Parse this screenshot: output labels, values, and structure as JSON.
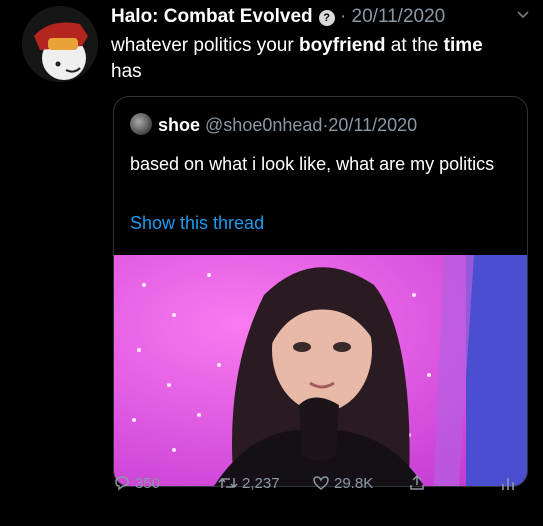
{
  "tweet": {
    "author_name": "Halo: Combat Evolved",
    "separator": "·",
    "date": "20/11/2020",
    "text_part1": "whatever politics your ",
    "text_bold1": "boyfriend",
    "text_part2": " at the ",
    "text_bold2": "time",
    "text_part3": " has"
  },
  "quote": {
    "author_name": "shoe",
    "handle": "@shoe0nhead",
    "separator": "·",
    "date": "20/11/2020",
    "text": "based on what i look like, what are my politics",
    "thread_link": "Show this thread"
  },
  "actions": {
    "replies": "350",
    "retweets": "2,237",
    "likes": "29.8K"
  },
  "colors": {
    "background": "#000000",
    "link": "#1d9bf0",
    "muted": "#8b98a5",
    "photo_backdrop": "#f254ec"
  },
  "icons": [
    "verified-badge-icon",
    "chevron-down-icon",
    "reply-icon",
    "retweet-icon",
    "like-icon",
    "share-icon",
    "analytics-icon"
  ]
}
